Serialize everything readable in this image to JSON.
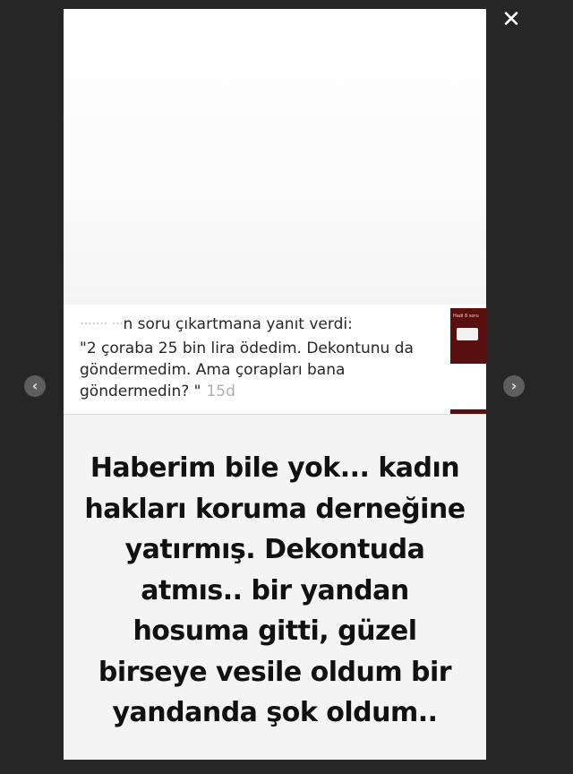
{
  "viewer": {
    "close_icon": "close-icon",
    "close_glyph": "✕",
    "prev_icon": "chevron-left-icon",
    "prev_glyph": "‹",
    "next_icon": "chevron-right-icon",
    "next_glyph": "›"
  },
  "reply": {
    "header_blurred": "·······    ···",
    "header_text": "n soru çıkartmana yanıt verdi:",
    "quote": "\"2 çoraba 25 bin lira ödedim. Dekontunu da göndermedim. Ama çorapları bana göndermedin? \"",
    "time": "15d",
    "thumb_label": "Hadi 8 soru"
  },
  "caption": {
    "lines": [
      "Haberim bile yok... kadın",
      "hakları koruma derneğine",
      "yatırmış. Dekontuda",
      "atmıs.. bir yandan",
      "hosuma gitti, güzel",
      "birseye vesile oldum bir",
      "yandanda şok oldum.."
    ]
  },
  "colors": {
    "backdrop": "#262626",
    "story_background": "#f4f4f4",
    "thumb_background": "#5a0f0f",
    "text_primary": "#262626",
    "time_text": "#b0b0b0"
  }
}
